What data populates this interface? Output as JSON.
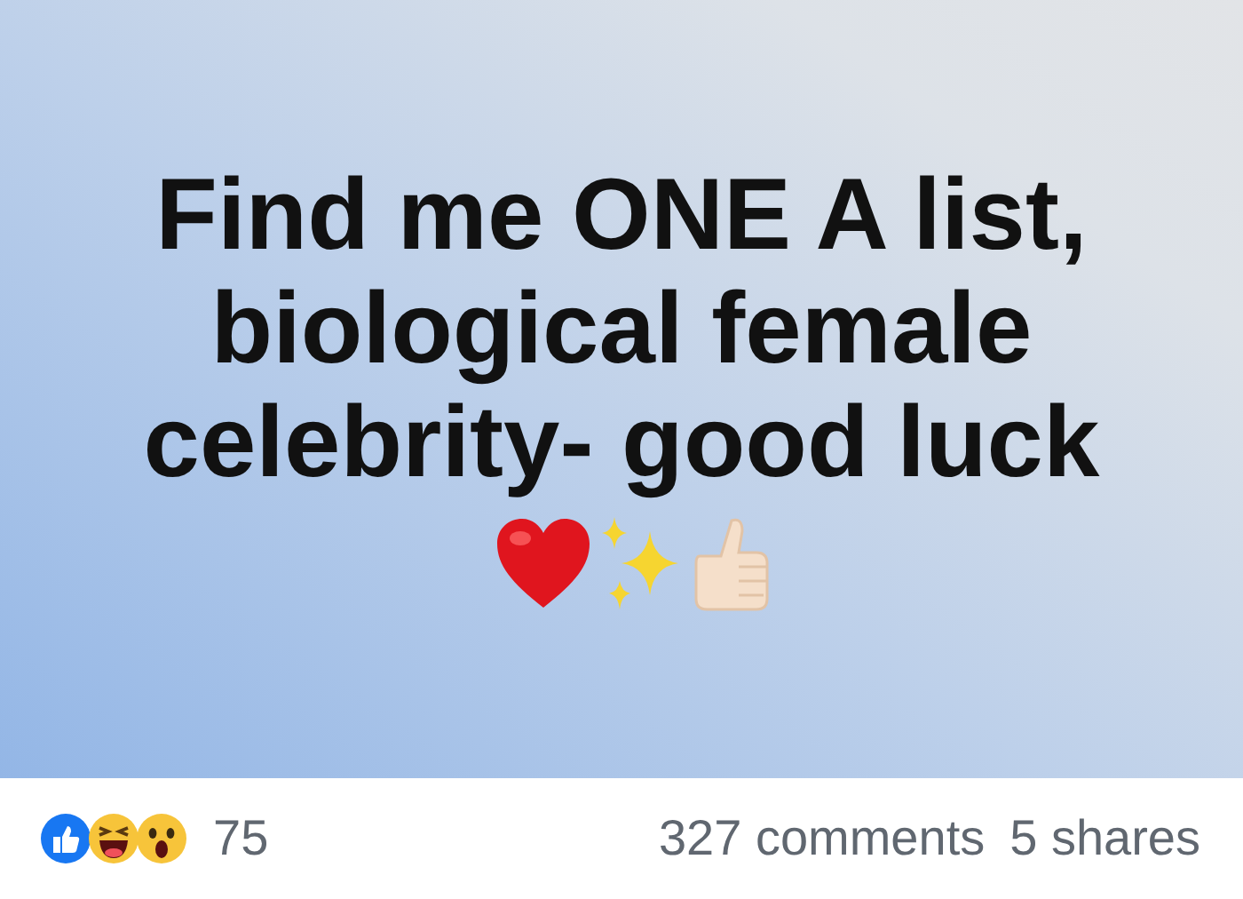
{
  "post": {
    "text": "Find me ONE A list, biological female celebrity- good luck"
  },
  "footer": {
    "reaction_count": "75",
    "comments": "327 comments",
    "shares": "5 shares"
  }
}
